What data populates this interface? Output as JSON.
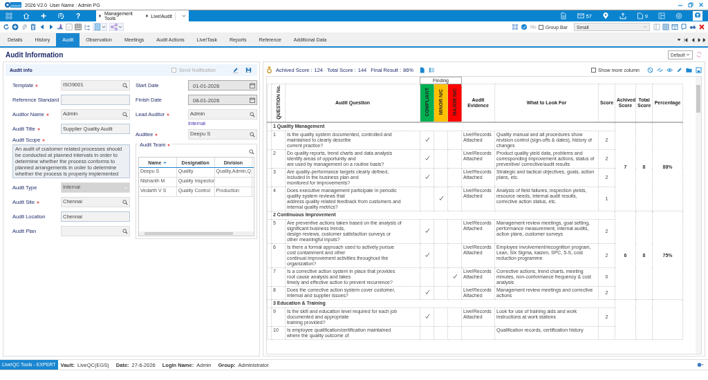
{
  "app": {
    "version": "2026 V2.0",
    "user": "User Name : Admin PG"
  },
  "nav": {
    "help": "?",
    "breadcrumb": [
      "Management Tools",
      "Live!Audit"
    ],
    "mail_count": "57",
    "folder_count": "9"
  },
  "toolbar": {
    "group_bar": {
      "label": "Group Bar",
      "checked": false
    },
    "size": "Small"
  },
  "tabs": [
    {
      "label": "Details",
      "selected": false
    },
    {
      "label": "History",
      "selected": false
    },
    {
      "label": "Audit",
      "selected": true
    },
    {
      "label": "Observation",
      "selected": false
    },
    {
      "label": "Meetings",
      "selected": false
    },
    {
      "label": "Audit Actions",
      "selected": false
    },
    {
      "label": "Live!Task",
      "selected": false
    },
    {
      "label": "Reports",
      "selected": false
    },
    {
      "label": "Reference",
      "selected": false
    },
    {
      "label": "Additional Data",
      "selected": false
    }
  ],
  "page": {
    "title": "Audit Information",
    "view": "Default"
  },
  "audit_info": {
    "title": "Audit info",
    "send_notification": {
      "label": "Send Notification",
      "checked": false
    },
    "left_fields": [
      {
        "kind": "lookup",
        "label": "Template",
        "required": true,
        "value": "ISO9001"
      },
      {
        "kind": "text",
        "label": "Reference Standard",
        "required": false
      },
      {
        "kind": "lookup",
        "label": "Auditor Name",
        "required": true,
        "value": "Admin"
      },
      {
        "kind": "text",
        "label": "Audit Title",
        "required": true,
        "value": "Supplier Quality Audit"
      },
      {
        "kind": "textarea",
        "label": "Audit Scope",
        "required": true,
        "value": "An audit of customer related processes should be conducted at planned intervals in order to determine whether the process conforms to planned arrangements in order to determine whether the process is properly implemented"
      },
      {
        "kind": "select",
        "label": "Audit Type",
        "required": false,
        "value": "Internal"
      },
      {
        "kind": "lookup",
        "label": "Audit Site",
        "required": true,
        "value": "Chennai"
      },
      {
        "kind": "text",
        "label": "Audit Location",
        "required": false,
        "value": "Chennai"
      },
      {
        "kind": "lookup",
        "label": "Audit Plan",
        "required": false
      }
    ],
    "right_fields": [
      {
        "kind": "date",
        "label": "Start Date",
        "required": false,
        "value": "01-01-2026"
      },
      {
        "kind": "date",
        "label": "Finish Date",
        "required": false,
        "value": "08-01-2026"
      },
      {
        "kind": "lookup",
        "label": "Lead Auditor",
        "required": true,
        "value": "Admin",
        "note": "Internal"
      },
      {
        "kind": "lookup",
        "label": "Auditee",
        "required": true,
        "value": "Deepu S"
      }
    ],
    "team": {
      "label": "Audit Team",
      "required": true,
      "columns": [
        "Name",
        "Designation",
        "Division"
      ],
      "rows": [
        {
          "name": "Deepu S",
          "designation": "Quality",
          "division": "Quality,Admin,Q"
        },
        {
          "name": "Nishanth M",
          "designation": "Quality Inspector"
        },
        {
          "name": "Vedarth V S",
          "designation": "Quality Control",
          "division": "Production"
        }
      ]
    }
  },
  "score_summary": {
    "achieved_label": "Achived Score :",
    "achieved": "124",
    "total_label": "Total Score :",
    "total": "144",
    "result_label": "Final Result :",
    "result": "86%"
  },
  "show_more_column": {
    "label": "Show more column",
    "checked": false
  },
  "table": {
    "finding_header": "Finding",
    "columns": {
      "question_no": "QUESTION No.",
      "question": "Audit Question",
      "evidence": "Audit Evidence",
      "look_for": "What to Look For",
      "score": "Score",
      "achieved": "Achived Score",
      "total": "Total Score",
      "percentage": "Percentage"
    },
    "findings": [
      {
        "label": "COMPLIANT",
        "color": "#00b050"
      },
      {
        "label": "MINOR N/C",
        "color": "#ffc000"
      },
      {
        "label": "MAJOR N/C",
        "color": "#ff0000"
      }
    ],
    "groups": [
      {
        "title": "1 Quality Management",
        "achieved": "7",
        "total": "8",
        "percentage": "88%",
        "questions": [
          {
            "no": "1",
            "text": "Is the quality system documented, controlled and\nmaintained to clearly describe\ncurrent practice?",
            "findings": [
              {
                "checked": true
              },
              {
                "checked": false
              },
              {
                "checked": false
              }
            ],
            "evidence": "Live!Records Attached",
            "look_for": "Quality manual and all procedures show revision control (sign-offs & dates), history of changes",
            "score": "2"
          },
          {
            "no": "2",
            "text": "Do quality reports, trend charts and data analysis\nidentify areas of opportunity and\nare used by management on a routine basis?",
            "findings": [
              {
                "checked": true
              },
              {
                "checked": false
              },
              {
                "checked": false
              }
            ],
            "evidence": "Live!Records Attached",
            "look_for": "Product quality yield data, problems and corresponding improvement actions, status of preventive/ corrective/audit results",
            "score": "2"
          },
          {
            "no": "3",
            "text": "Are quality-performance targets clearly defined,\nincluded in the business plan and\nmonitored for improvements?",
            "findings": [
              {
                "checked": true
              },
              {
                "checked": false
              },
              {
                "checked": false
              }
            ],
            "evidence": "Live!Records Attached",
            "look_for": "Strategic and tactical objectives, goals, action plans, etc.",
            "score": "2"
          },
          {
            "no": "4",
            "text": "Does executive management participate in periodic\nquality system reviews that\naddress quality related feedback from customers and\ninternal quality metrics?",
            "findings": [
              {
                "checked": false
              },
              {
                "checked": true
              },
              {
                "checked": false
              }
            ],
            "evidence": "Live!Records Attached",
            "look_for": "Analysis of field failures, inspection yields, resource needs, internal audit results, corrective action status, etc.",
            "score": "1"
          }
        ]
      },
      {
        "title": "2 Continuous Improvement",
        "achieved": "6",
        "total": "8",
        "percentage": "75%",
        "questions": [
          {
            "no": "5",
            "text": "Are preventive actions taken based on the analysis of\nsignificant business trends,\ndesign reviews, customer satisfaction surveys or\nother meaningful inputs?",
            "findings": [
              {
                "checked": true
              },
              {
                "checked": false
              },
              {
                "checked": false
              }
            ],
            "evidence": "Live!Records Attached",
            "look_for": "Management review meetings, goal setting, performance measurement, internal audits, action plans, customer surveys",
            "score": "2"
          },
          {
            "no": "6",
            "text": "Is there a formal approach used to actively pursue\ncost containment and other\ncontinual improvement activities throughout the\norganization?",
            "findings": [
              {
                "checked": true
              },
              {
                "checked": false
              },
              {
                "checked": false
              }
            ],
            "evidence": "Live!Records Attached",
            "look_for": "Employee involvement/recognition program, Lean, Six Sigma, kaizen, SPC, 5-S, cost reduction programme",
            "score": "2"
          },
          {
            "no": "7",
            "text": "Is a corrective action system in place that provides\nroot cause analysis and takes\ntimely and effective action to prevent recurrence?",
            "findings": [
              {
                "checked": false
              },
              {
                "checked": false
              },
              {
                "checked": true
              }
            ],
            "evidence": "Live!Records Attached",
            "look_for": "Corrective actions, trend charts, meeting minutes, non-conformance frequency & cost analysis",
            "score": "0"
          },
          {
            "no": "8",
            "text": "Does the corrective action system cover customer,\ninternal and supplier issues?",
            "findings": [
              {
                "checked": true
              },
              {
                "checked": false
              },
              {
                "checked": false
              }
            ],
            "evidence": "Live!Records Attached",
            "look_for": "Management review meetings and corrective actions",
            "score": "2"
          }
        ]
      },
      {
        "title": "3 Education & Training",
        "questions": [
          {
            "no": "9",
            "text": "Is the skill and education level required for each job\ndocumented and appropriate\ntraining provided?",
            "findings": [
              {
                "checked": true
              },
              {
                "checked": false
              },
              {
                "checked": false
              }
            ],
            "evidence": "Live!Records Attached",
            "look_for": "Look for use of training aids and work instructions at work stations",
            "score": "2"
          },
          {
            "no": "10",
            "text": "Is employee qualification/certification maintained\nwhere the quality outcome of",
            "look_for": "Qualification records, certification history"
          }
        ]
      }
    ]
  },
  "status": {
    "product": "Live!QC Tools - EXPERT",
    "items": [
      {
        "label": "Vault:",
        "value": "LiveQC(EGS)"
      },
      {
        "label": "Date:",
        "value": "27-6-2026"
      },
      {
        "label": "Login Name:",
        "value": "Admin"
      },
      {
        "label": "Group:",
        "value": "Administrator"
      }
    ]
  }
}
